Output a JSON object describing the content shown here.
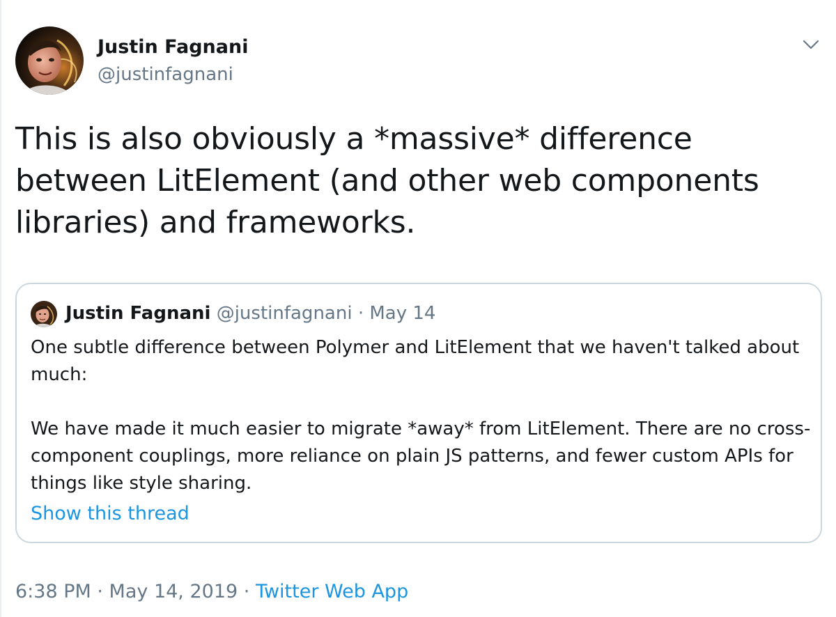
{
  "tweet": {
    "author_name": "Justin Fagnani",
    "author_handle": "@justinfagnani",
    "text": "This is also obviously a *massive* difference between LitElement (and other web components libraries) and frameworks.",
    "timestamp": "6:38 PM · May 14, 2019",
    "separator": " · ",
    "source": "Twitter Web App"
  },
  "quoted_tweet": {
    "author_name": "Justin Fagnani",
    "author_handle": "@justinfagnani",
    "separator": "·",
    "date": "May 14",
    "paragraph_1": "One subtle difference between Polymer and LitElement that we haven't talked about much:",
    "paragraph_2": "We have made it much easier to migrate *away* from LitElement. There are no cross-component couplings, more reliance on plain JS patterns, and fewer custom APIs for things like style sharing.",
    "show_thread": "Show this thread"
  },
  "icons": {
    "avatar": "profile-photo",
    "menu": "chevron-down-icon"
  },
  "colors": {
    "text": "#14171a",
    "secondary": "#657786",
    "link": "#1b95e0",
    "border": "#ccd6dd"
  }
}
